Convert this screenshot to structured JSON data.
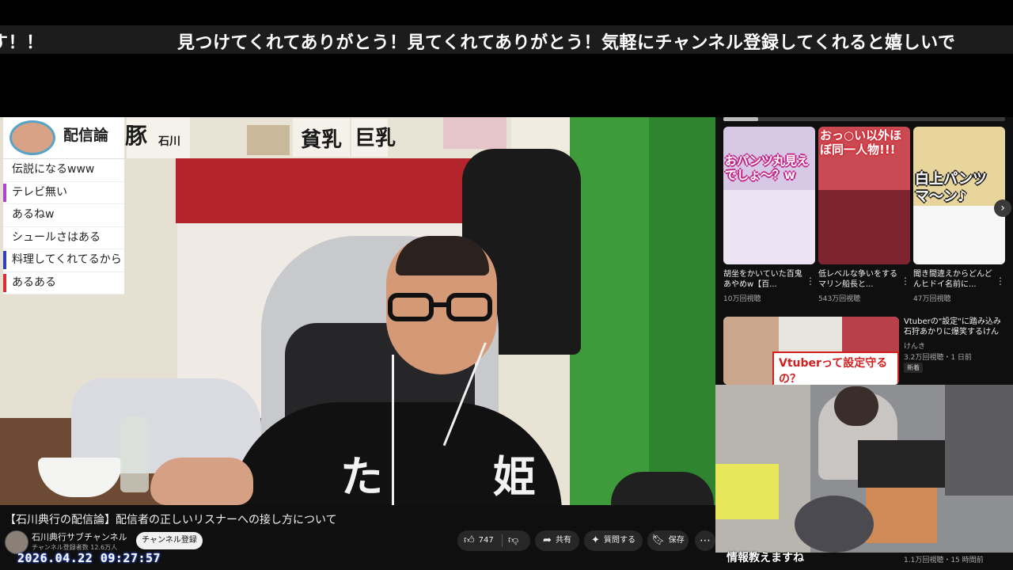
{
  "ticker": {
    "segment_a": "す！！",
    "segment_b": "見つけてくれてありがとう！見てくれてありがとう！気軽にチャンネル登録してくれると嬉しいで"
  },
  "video": {
    "poster_texts": [
      "豚",
      "石川",
      "貧乳",
      "巨乳"
    ],
    "shirt_text": "た 姫"
  },
  "chat": {
    "title": "配信論",
    "messages": [
      {
        "text": "伝説になるwww",
        "color": "#ffffff"
      },
      {
        "text": "テレビ無い",
        "color": "#b042d6"
      },
      {
        "text": "あるねw",
        "color": "#ffffff"
      },
      {
        "text": "シュールさはある",
        "color": "#ffffff"
      },
      {
        "text": "料理してくれてるから",
        "color": "#2f3fbf"
      },
      {
        "text": "あるある",
        "color": "#d83030"
      }
    ]
  },
  "meta": {
    "title": "【石川典行の配信論】配信者の正しいリスナーへの接し方について",
    "channel_name": "石川典行サブチャンネル",
    "subscribers": "チャンネル登録者数 12.6万人",
    "subscribe_label": "チャンネル登録",
    "like_count": "747",
    "share_label": "共有",
    "thanks_label": "質問する",
    "save_label": "保存",
    "more_label": "⋯",
    "timestamp": "2026.04.22 09:27:57"
  },
  "sidebar": {
    "shorts": [
      {
        "caption": "おパンツ丸見えでしょ〜？w",
        "title": "胡坐をかいていた百鬼あやめw【百...",
        "views": "10万回視聴",
        "bg": "#d7c8e6"
      },
      {
        "caption": "おっ○い以外ほぼ同一人物!!!",
        "title": "低レベルな争いをするマリン船長と...",
        "views": "543万回視聴",
        "bg": "#c94a52"
      },
      {
        "caption": "白上パンツマ〜ン♪",
        "title": "聞き間違えからどんどんヒドイ名前に...",
        "views": "47万回視聴",
        "bg": "#e8d59c"
      }
    ],
    "video": {
      "overlay": "Vtuberって設定守るの？",
      "title": "Vtuberの\"設定\"に踏み込み石狩あかりに爆笑するけんき(メ...",
      "channel": "けんき",
      "views": "3.2万回視聴・1 日前",
      "badge": "新着"
    }
  },
  "under_pip": {
    "overlay": "情報教えますね",
    "views": "1.1万回視聴・15 時間前"
  }
}
